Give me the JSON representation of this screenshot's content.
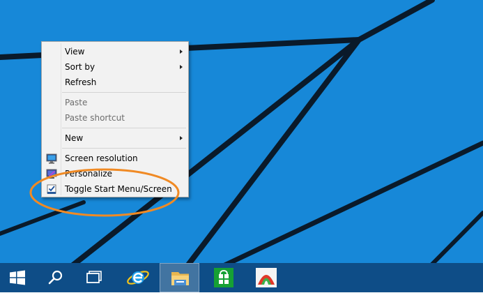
{
  "desktop": {
    "background_color": "#1788d8",
    "stripe_color": "#0a1a2a"
  },
  "context_menu": {
    "items": [
      {
        "label": "View",
        "has_submenu": true,
        "enabled": true
      },
      {
        "label": "Sort by",
        "has_submenu": true,
        "enabled": true
      },
      {
        "label": "Refresh",
        "has_submenu": false,
        "enabled": true
      },
      {
        "label": "Paste",
        "has_submenu": false,
        "enabled": false
      },
      {
        "label": "Paste shortcut",
        "has_submenu": false,
        "enabled": false
      },
      {
        "label": "New",
        "has_submenu": true,
        "enabled": true
      },
      {
        "label": "Screen resolution",
        "icon": "screen-resolution-icon",
        "enabled": true
      },
      {
        "label": "Personalize",
        "icon": "personalize-icon",
        "enabled": true
      },
      {
        "label": "Toggle Start Menu/Screen",
        "icon": "toggle-start-icon",
        "enabled": true
      }
    ]
  },
  "annotation": {
    "color": "#f08a24",
    "shape": "ellipse"
  },
  "taskbar": {
    "background_color": "#0e4d87",
    "buttons": [
      {
        "icon": "windows-start-icon",
        "active": false
      },
      {
        "icon": "search-icon",
        "active": false
      },
      {
        "icon": "task-view-icon",
        "active": false
      },
      {
        "icon": "internet-explorer-icon",
        "active": false
      },
      {
        "icon": "file-explorer-icon",
        "active": true
      },
      {
        "icon": "store-icon",
        "active": false
      },
      {
        "icon": "paint-app-icon",
        "active": false
      }
    ]
  }
}
